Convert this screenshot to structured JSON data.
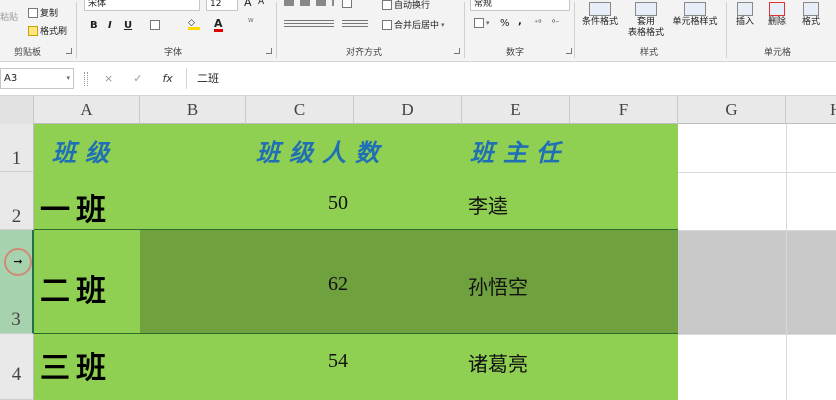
{
  "ribbon": {
    "clipboard": {
      "paste": "粘贴",
      "copy": "复制",
      "format_painter": "格式刷",
      "label": "剪贴板"
    },
    "font": {
      "name": "宋体",
      "size": "12",
      "bold": "B",
      "italic": "I",
      "underline": "U",
      "label": "字体"
    },
    "alignment": {
      "wrap": "自动换行",
      "merge": "合并后居中",
      "label": "对齐方式"
    },
    "number": {
      "format": "常规",
      "percent": "%",
      "comma": ",",
      "label": "数字"
    },
    "styles": {
      "conditional": "条件格式",
      "table_line1": "套用",
      "table_line2": "表格格式",
      "cell_styles": "单元格样式",
      "label": "样式"
    },
    "cells": {
      "insert": "插入",
      "delete": "删除",
      "format": "格式",
      "label": "单元格"
    }
  },
  "formula_bar": {
    "name_box": "A3",
    "cancel": "×",
    "enter": "✓",
    "fx": "fx",
    "content": "二班"
  },
  "columns": [
    "A",
    "B",
    "C",
    "D",
    "E",
    "F",
    "G",
    "H"
  ],
  "rows": [
    "1",
    "2",
    "3",
    "4"
  ],
  "sheet": {
    "header": {
      "class": "班级",
      "count": "班级人数",
      "teacher": "班主任"
    },
    "records": [
      {
        "class": "一班",
        "count": "50",
        "teacher": "李逵"
      },
      {
        "class": "二班",
        "count": "62",
        "teacher": "孙悟空"
      },
      {
        "class": "三班",
        "count": "54",
        "teacher": "诸葛亮"
      }
    ]
  },
  "colors": {
    "fill": "#8fcf52",
    "selected_fill": "#70a13f",
    "selected_empty": "#c9c9c9",
    "header_text": "#1f6fb5"
  }
}
